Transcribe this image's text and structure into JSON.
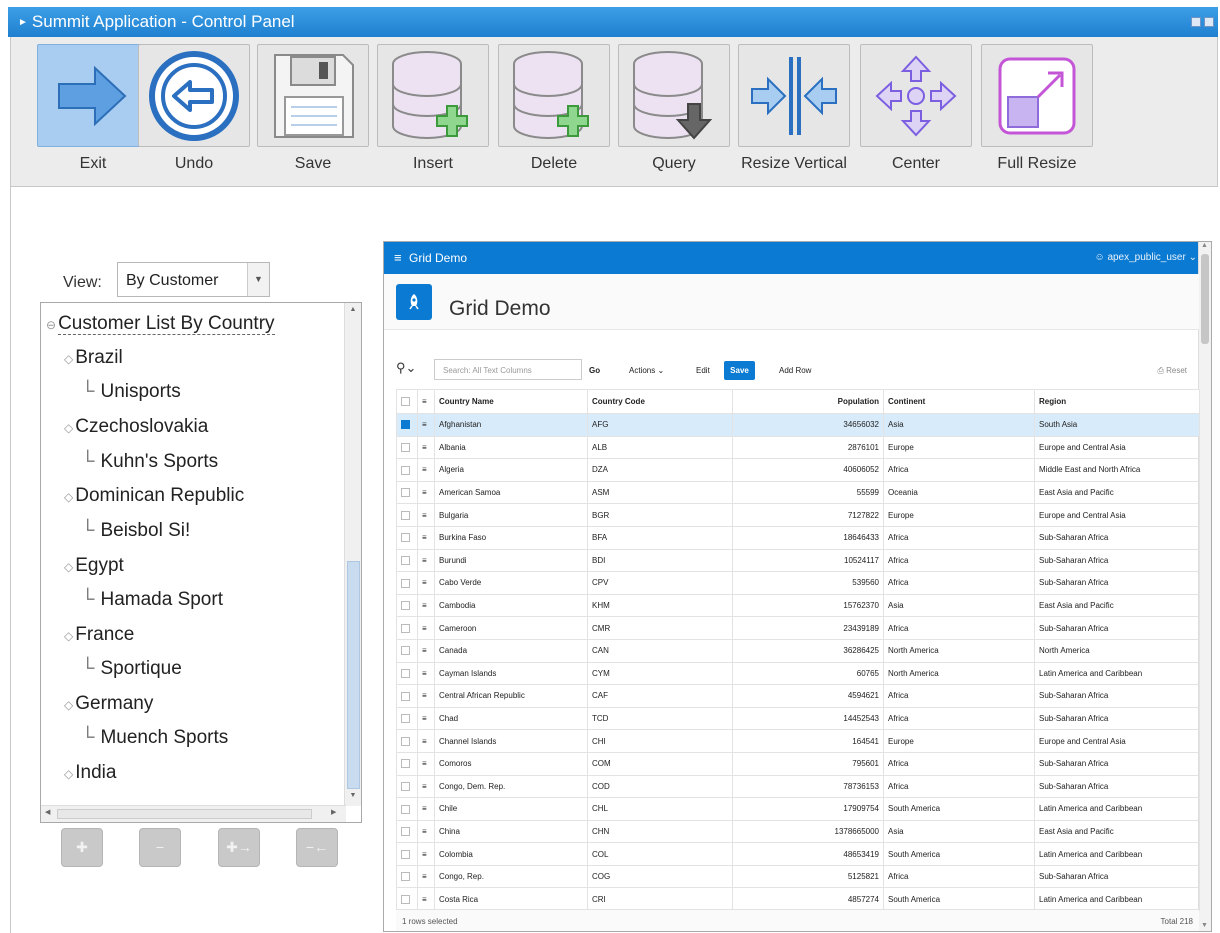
{
  "window": {
    "title": "Summit Application - Control Panel"
  },
  "toolbar": {
    "buttons": [
      {
        "label": "Exit",
        "icon": "exit-arrow-icon"
      },
      {
        "label": "Undo",
        "icon": "undo-icon"
      },
      {
        "label": "Save",
        "icon": "floppy-disk-icon"
      },
      {
        "label": "Insert",
        "icon": "database-add-icon"
      },
      {
        "label": "Delete",
        "icon": "database-add-icon"
      },
      {
        "label": "Query",
        "icon": "database-query-icon"
      },
      {
        "label": "Resize Vertical",
        "icon": "resize-vertical-icon"
      },
      {
        "label": "Center",
        "icon": "center-icon"
      },
      {
        "label": "Full Resize",
        "icon": "full-resize-icon"
      }
    ]
  },
  "view": {
    "label": "View:",
    "selected": "By Customer"
  },
  "tree": {
    "root": "Customer List By Country",
    "countries": [
      {
        "name": "Brazil",
        "customer": "Unisports"
      },
      {
        "name": "Czechoslovakia",
        "customer": "Kuhn's Sports"
      },
      {
        "name": "Dominican Republic",
        "customer": "Beisbol Si!"
      },
      {
        "name": "Egypt",
        "customer": "Hamada Sport"
      },
      {
        "name": "France",
        "customer": "Sportique"
      },
      {
        "name": "Germany",
        "customer": "Muench Sports"
      },
      {
        "name": "India",
        "customer": ""
      }
    ]
  },
  "tree_buttons": {
    "icons": [
      "expand-icon",
      "collapse-icon",
      "expand-all-icon",
      "collapse-all-icon"
    ]
  },
  "apex": {
    "header_title": "Grid Demo",
    "user": "apex_public_user",
    "region_title": "Grid Demo",
    "search_placeholder": "Search: All Text Columns",
    "go": "Go",
    "actions": "Actions",
    "edit": "Edit",
    "save": "Save",
    "add_row": "Add Row",
    "reset": "Reset",
    "columns": [
      "Country Name",
      "Country Code",
      "Population",
      "Continent",
      "Region"
    ],
    "rows": [
      [
        "Afghanistan",
        "AFG",
        "34656032",
        "Asia",
        "South Asia"
      ],
      [
        "Albania",
        "ALB",
        "2876101",
        "Europe",
        "Europe and Central Asia"
      ],
      [
        "Algeria",
        "DZA",
        "40606052",
        "Africa",
        "Middle East and North Africa"
      ],
      [
        "American Samoa",
        "ASM",
        "55599",
        "Oceania",
        "East Asia and Pacific"
      ],
      [
        "Bulgaria",
        "BGR",
        "7127822",
        "Europe",
        "Europe and Central Asia"
      ],
      [
        "Burkina Faso",
        "BFA",
        "18646433",
        "Africa",
        "Sub-Saharan Africa"
      ],
      [
        "Burundi",
        "BDI",
        "10524117",
        "Africa",
        "Sub-Saharan Africa"
      ],
      [
        "Cabo Verde",
        "CPV",
        "539560",
        "Africa",
        "Sub-Saharan Africa"
      ],
      [
        "Cambodia",
        "KHM",
        "15762370",
        "Asia",
        "East Asia and Pacific"
      ],
      [
        "Cameroon",
        "CMR",
        "23439189",
        "Africa",
        "Sub-Saharan Africa"
      ],
      [
        "Canada",
        "CAN",
        "36286425",
        "North America",
        "North America"
      ],
      [
        "Cayman Islands",
        "CYM",
        "60765",
        "North America",
        "Latin America and Caribbean"
      ],
      [
        "Central African Republic",
        "CAF",
        "4594621",
        "Africa",
        "Sub-Saharan Africa"
      ],
      [
        "Chad",
        "TCD",
        "14452543",
        "Africa",
        "Sub-Saharan Africa"
      ],
      [
        "Channel Islands",
        "CHI",
        "164541",
        "Europe",
        "Europe and Central Asia"
      ],
      [
        "Comoros",
        "COM",
        "795601",
        "Africa",
        "Sub-Saharan Africa"
      ],
      [
        "Congo, Dem. Rep.",
        "COD",
        "78736153",
        "Africa",
        "Sub-Saharan Africa"
      ],
      [
        "Chile",
        "CHL",
        "17909754",
        "South America",
        "Latin America and Caribbean"
      ],
      [
        "China",
        "CHN",
        "1378665000",
        "Asia",
        "East Asia and Pacific"
      ],
      [
        "Colombia",
        "COL",
        "48653419",
        "South America",
        "Latin America and Caribbean"
      ],
      [
        "Congo, Rep.",
        "COG",
        "5125821",
        "Africa",
        "Sub-Saharan Africa"
      ],
      [
        "Costa Rica",
        "CRI",
        "4857274",
        "South America",
        "Latin America and Caribbean"
      ]
    ],
    "selected_row": 0,
    "footer_left": "1 rows selected",
    "footer_right": "Total 218"
  }
}
